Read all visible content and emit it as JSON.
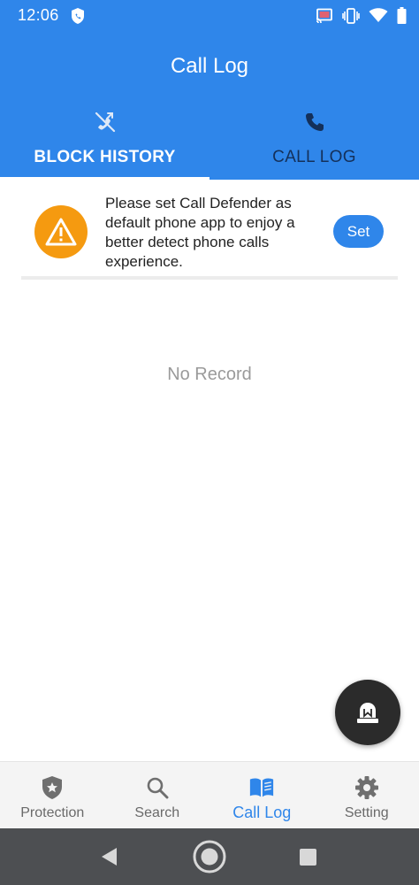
{
  "status_bar": {
    "time": "12:06",
    "icons": [
      "shield-notification-icon",
      "cast-icon",
      "vibrate-icon",
      "wifi-icon",
      "battery-icon"
    ]
  },
  "header": {
    "title": "Call Log"
  },
  "tabs": [
    {
      "label": "BLOCK HISTORY",
      "icon": "call-blocked-icon",
      "active": true
    },
    {
      "label": "CALL LOG",
      "icon": "phone-icon",
      "active": false
    }
  ],
  "banner": {
    "icon": "warning-icon",
    "message": "Please set Call Defender as default phone app to enjoy a better detect phone calls experience.",
    "button_label": "Set"
  },
  "empty_state": {
    "text": "No Record"
  },
  "fab": {
    "icon": "alarm-siren-icon"
  },
  "bottom_nav": [
    {
      "label": "Protection",
      "icon": "shield-star-icon",
      "active": false
    },
    {
      "label": "Search",
      "icon": "search-icon",
      "active": false
    },
    {
      "label": "Call Log",
      "icon": "book-icon",
      "active": true
    },
    {
      "label": "Setting",
      "icon": "gear-icon",
      "active": false
    }
  ],
  "colors": {
    "primary": "#2f86ea",
    "warning": "#f59a10",
    "inactive_tab": "#14305a",
    "muted_text": "#9a9a9a",
    "fab": "#2b2b2b",
    "system_nav": "#4d4f52"
  }
}
